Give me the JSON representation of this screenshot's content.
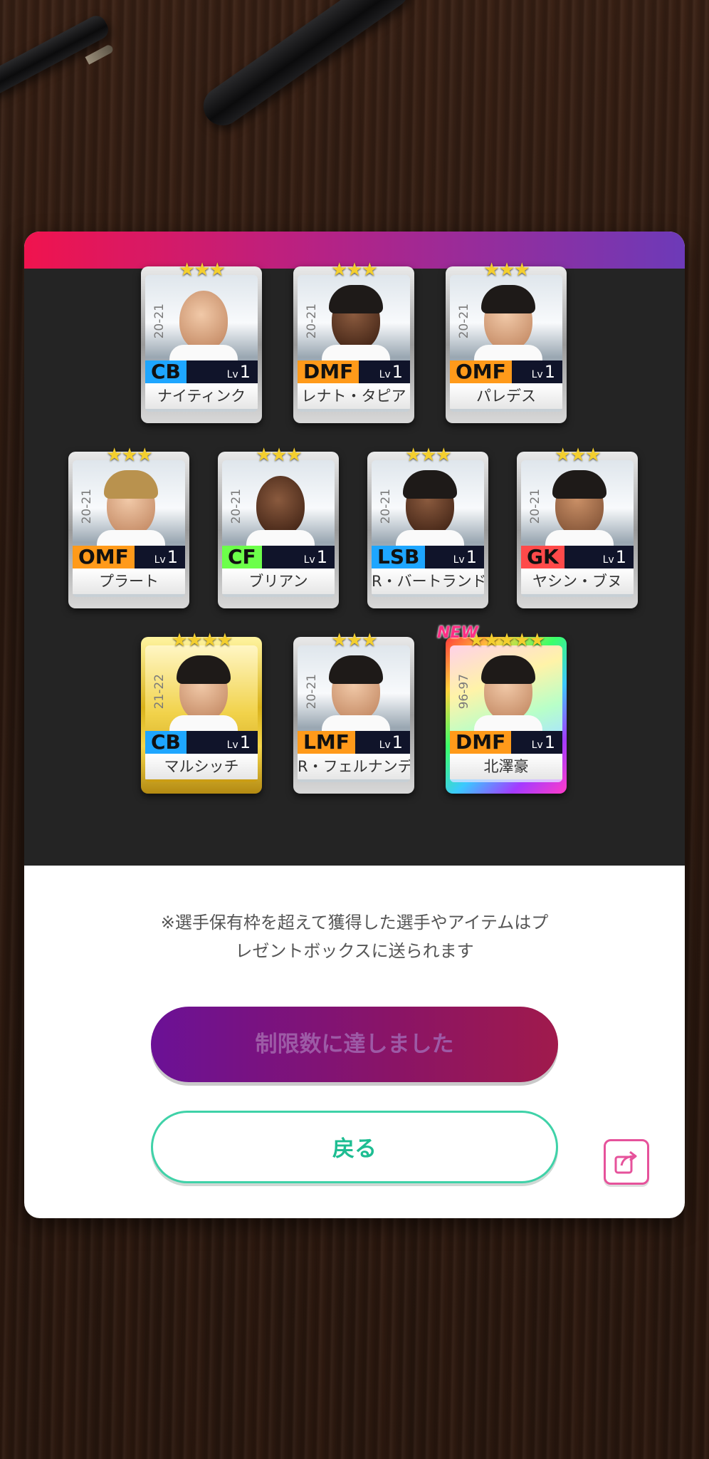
{
  "cards": [
    {
      "stars": "★★★",
      "season": "20-21",
      "position": "CB",
      "pos_color": "#1ea6ff",
      "lv_prefix": "Lv",
      "level": "1",
      "name": "ナイティンク",
      "style": "silver",
      "skin": "light",
      "hair": "none",
      "new": ""
    },
    {
      "stars": "★★★",
      "season": "20-21",
      "position": "DMF",
      "pos_color": "#ff9a1a",
      "lv_prefix": "Lv",
      "level": "1",
      "name": "レナト・タピア",
      "style": "silver",
      "skin": "dark",
      "hair": "black",
      "new": ""
    },
    {
      "stars": "★★★",
      "season": "20-21",
      "position": "OMF",
      "pos_color": "#ff9a1a",
      "lv_prefix": "Lv",
      "level": "1",
      "name": "パレデス",
      "style": "silver",
      "skin": "light",
      "hair": "black",
      "new": ""
    },
    {
      "stars": "★★★",
      "season": "20-21",
      "position": "OMF",
      "pos_color": "#ff9a1a",
      "lv_prefix": "Lv",
      "level": "1",
      "name": "プラート",
      "style": "silver",
      "skin": "light",
      "hair": "blond",
      "new": ""
    },
    {
      "stars": "★★★",
      "season": "20-21",
      "position": "CF",
      "pos_color": "#6cff4a",
      "lv_prefix": "Lv",
      "level": "1",
      "name": "ブリアン",
      "style": "silver",
      "skin": "dark",
      "hair": "none",
      "new": ""
    },
    {
      "stars": "★★★",
      "season": "20-21",
      "position": "LSB",
      "pos_color": "#1ea6ff",
      "lv_prefix": "Lv",
      "level": "1",
      "name": "R・バートランド",
      "style": "silver",
      "skin": "dark",
      "hair": "black",
      "new": ""
    },
    {
      "stars": "★★★",
      "season": "20-21",
      "position": "GK",
      "pos_color": "#ff4a4a",
      "lv_prefix": "Lv",
      "level": "1",
      "name": "ヤシン・ブヌ",
      "style": "silver",
      "skin": "mid",
      "hair": "black",
      "new": ""
    },
    {
      "stars": "★★★★",
      "season": "21-22",
      "position": "CB",
      "pos_color": "#1ea6ff",
      "lv_prefix": "Lv",
      "level": "1",
      "name": "マルシッチ",
      "style": "gold",
      "skin": "light",
      "hair": "black",
      "new": ""
    },
    {
      "stars": "★★★",
      "season": "20-21",
      "position": "LMF",
      "pos_color": "#ff9a1a",
      "lv_prefix": "Lv",
      "level": "1",
      "name": "R・フェルナンデ",
      "style": "silver",
      "skin": "light",
      "hair": "black",
      "new": ""
    },
    {
      "stars": "★★★★★",
      "season": "96-97",
      "position": "DMF",
      "pos_color": "#ff9a1a",
      "lv_prefix": "Lv",
      "level": "1",
      "name": "北澤豪",
      "style": "rainbow",
      "skin": "light",
      "hair": "black",
      "new": "NEW"
    }
  ],
  "notice": {
    "line1": "※選手保有枠を超えて獲得した選手やアイテムはプ",
    "line2": "レゼントボックスに送られます"
  },
  "buttons": {
    "limit_label": "制限数に達しました",
    "back_label": "戻る",
    "share_icon": "share-icon"
  }
}
